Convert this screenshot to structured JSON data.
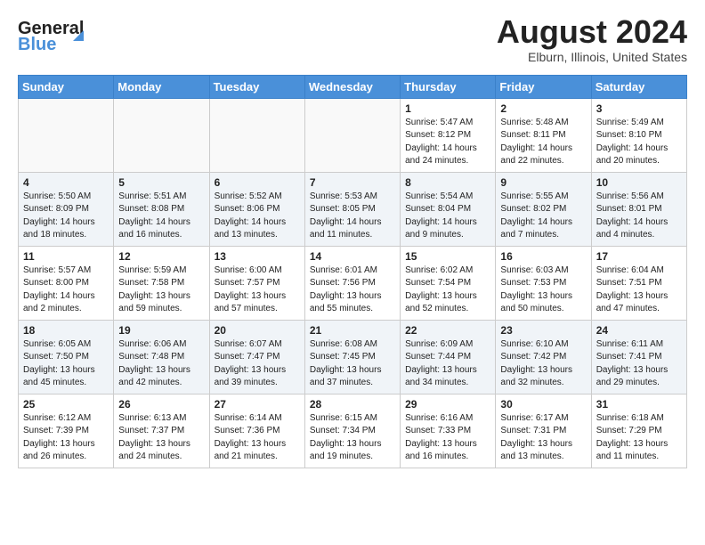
{
  "header": {
    "logo_general": "General",
    "logo_blue": "Blue",
    "month": "August 2024",
    "location": "Elburn, Illinois, United States"
  },
  "weekdays": [
    "Sunday",
    "Monday",
    "Tuesday",
    "Wednesday",
    "Thursday",
    "Friday",
    "Saturday"
  ],
  "weeks": [
    [
      {
        "day": "",
        "info": ""
      },
      {
        "day": "",
        "info": ""
      },
      {
        "day": "",
        "info": ""
      },
      {
        "day": "",
        "info": ""
      },
      {
        "day": "1",
        "info": "Sunrise: 5:47 AM\nSunset: 8:12 PM\nDaylight: 14 hours\nand 24 minutes."
      },
      {
        "day": "2",
        "info": "Sunrise: 5:48 AM\nSunset: 8:11 PM\nDaylight: 14 hours\nand 22 minutes."
      },
      {
        "day": "3",
        "info": "Sunrise: 5:49 AM\nSunset: 8:10 PM\nDaylight: 14 hours\nand 20 minutes."
      }
    ],
    [
      {
        "day": "4",
        "info": "Sunrise: 5:50 AM\nSunset: 8:09 PM\nDaylight: 14 hours\nand 18 minutes."
      },
      {
        "day": "5",
        "info": "Sunrise: 5:51 AM\nSunset: 8:08 PM\nDaylight: 14 hours\nand 16 minutes."
      },
      {
        "day": "6",
        "info": "Sunrise: 5:52 AM\nSunset: 8:06 PM\nDaylight: 14 hours\nand 13 minutes."
      },
      {
        "day": "7",
        "info": "Sunrise: 5:53 AM\nSunset: 8:05 PM\nDaylight: 14 hours\nand 11 minutes."
      },
      {
        "day": "8",
        "info": "Sunrise: 5:54 AM\nSunset: 8:04 PM\nDaylight: 14 hours\nand 9 minutes."
      },
      {
        "day": "9",
        "info": "Sunrise: 5:55 AM\nSunset: 8:02 PM\nDaylight: 14 hours\nand 7 minutes."
      },
      {
        "day": "10",
        "info": "Sunrise: 5:56 AM\nSunset: 8:01 PM\nDaylight: 14 hours\nand 4 minutes."
      }
    ],
    [
      {
        "day": "11",
        "info": "Sunrise: 5:57 AM\nSunset: 8:00 PM\nDaylight: 14 hours\nand 2 minutes."
      },
      {
        "day": "12",
        "info": "Sunrise: 5:59 AM\nSunset: 7:58 PM\nDaylight: 13 hours\nand 59 minutes."
      },
      {
        "day": "13",
        "info": "Sunrise: 6:00 AM\nSunset: 7:57 PM\nDaylight: 13 hours\nand 57 minutes."
      },
      {
        "day": "14",
        "info": "Sunrise: 6:01 AM\nSunset: 7:56 PM\nDaylight: 13 hours\nand 55 minutes."
      },
      {
        "day": "15",
        "info": "Sunrise: 6:02 AM\nSunset: 7:54 PM\nDaylight: 13 hours\nand 52 minutes."
      },
      {
        "day": "16",
        "info": "Sunrise: 6:03 AM\nSunset: 7:53 PM\nDaylight: 13 hours\nand 50 minutes."
      },
      {
        "day": "17",
        "info": "Sunrise: 6:04 AM\nSunset: 7:51 PM\nDaylight: 13 hours\nand 47 minutes."
      }
    ],
    [
      {
        "day": "18",
        "info": "Sunrise: 6:05 AM\nSunset: 7:50 PM\nDaylight: 13 hours\nand 45 minutes."
      },
      {
        "day": "19",
        "info": "Sunrise: 6:06 AM\nSunset: 7:48 PM\nDaylight: 13 hours\nand 42 minutes."
      },
      {
        "day": "20",
        "info": "Sunrise: 6:07 AM\nSunset: 7:47 PM\nDaylight: 13 hours\nand 39 minutes."
      },
      {
        "day": "21",
        "info": "Sunrise: 6:08 AM\nSunset: 7:45 PM\nDaylight: 13 hours\nand 37 minutes."
      },
      {
        "day": "22",
        "info": "Sunrise: 6:09 AM\nSunset: 7:44 PM\nDaylight: 13 hours\nand 34 minutes."
      },
      {
        "day": "23",
        "info": "Sunrise: 6:10 AM\nSunset: 7:42 PM\nDaylight: 13 hours\nand 32 minutes."
      },
      {
        "day": "24",
        "info": "Sunrise: 6:11 AM\nSunset: 7:41 PM\nDaylight: 13 hours\nand 29 minutes."
      }
    ],
    [
      {
        "day": "25",
        "info": "Sunrise: 6:12 AM\nSunset: 7:39 PM\nDaylight: 13 hours\nand 26 minutes."
      },
      {
        "day": "26",
        "info": "Sunrise: 6:13 AM\nSunset: 7:37 PM\nDaylight: 13 hours\nand 24 minutes."
      },
      {
        "day": "27",
        "info": "Sunrise: 6:14 AM\nSunset: 7:36 PM\nDaylight: 13 hours\nand 21 minutes."
      },
      {
        "day": "28",
        "info": "Sunrise: 6:15 AM\nSunset: 7:34 PM\nDaylight: 13 hours\nand 19 minutes."
      },
      {
        "day": "29",
        "info": "Sunrise: 6:16 AM\nSunset: 7:33 PM\nDaylight: 13 hours\nand 16 minutes."
      },
      {
        "day": "30",
        "info": "Sunrise: 6:17 AM\nSunset: 7:31 PM\nDaylight: 13 hours\nand 13 minutes."
      },
      {
        "day": "31",
        "info": "Sunrise: 6:18 AM\nSunset: 7:29 PM\nDaylight: 13 hours\nand 11 minutes."
      }
    ]
  ]
}
